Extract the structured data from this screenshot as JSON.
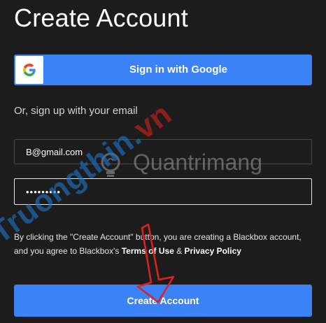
{
  "title": "Create Account",
  "google_button": {
    "label": "Sign in with Google",
    "icon": "google-g-logo"
  },
  "divider_text": "Or, sign up with your email",
  "email_field": {
    "value": "B@gmail.com"
  },
  "password_field": {
    "value": "•••••••••"
  },
  "terms": {
    "part1": "By clicking the \"Create Account\" button, you are creating a Blackbox account, and you agree to Blackbox's ",
    "terms_link": "Terms of Use",
    "and": " & ",
    "privacy_link": "Privacy Policy"
  },
  "create_button": {
    "label": "Create Account"
  },
  "watermarks": {
    "quantrimang": "Quantrimang",
    "diagonal_main": "Truongthin.",
    "diagonal_vn": "vn"
  },
  "colors": {
    "background": "#1c1c1c",
    "accent": "#3b82f6",
    "arrow": "#e02020"
  }
}
